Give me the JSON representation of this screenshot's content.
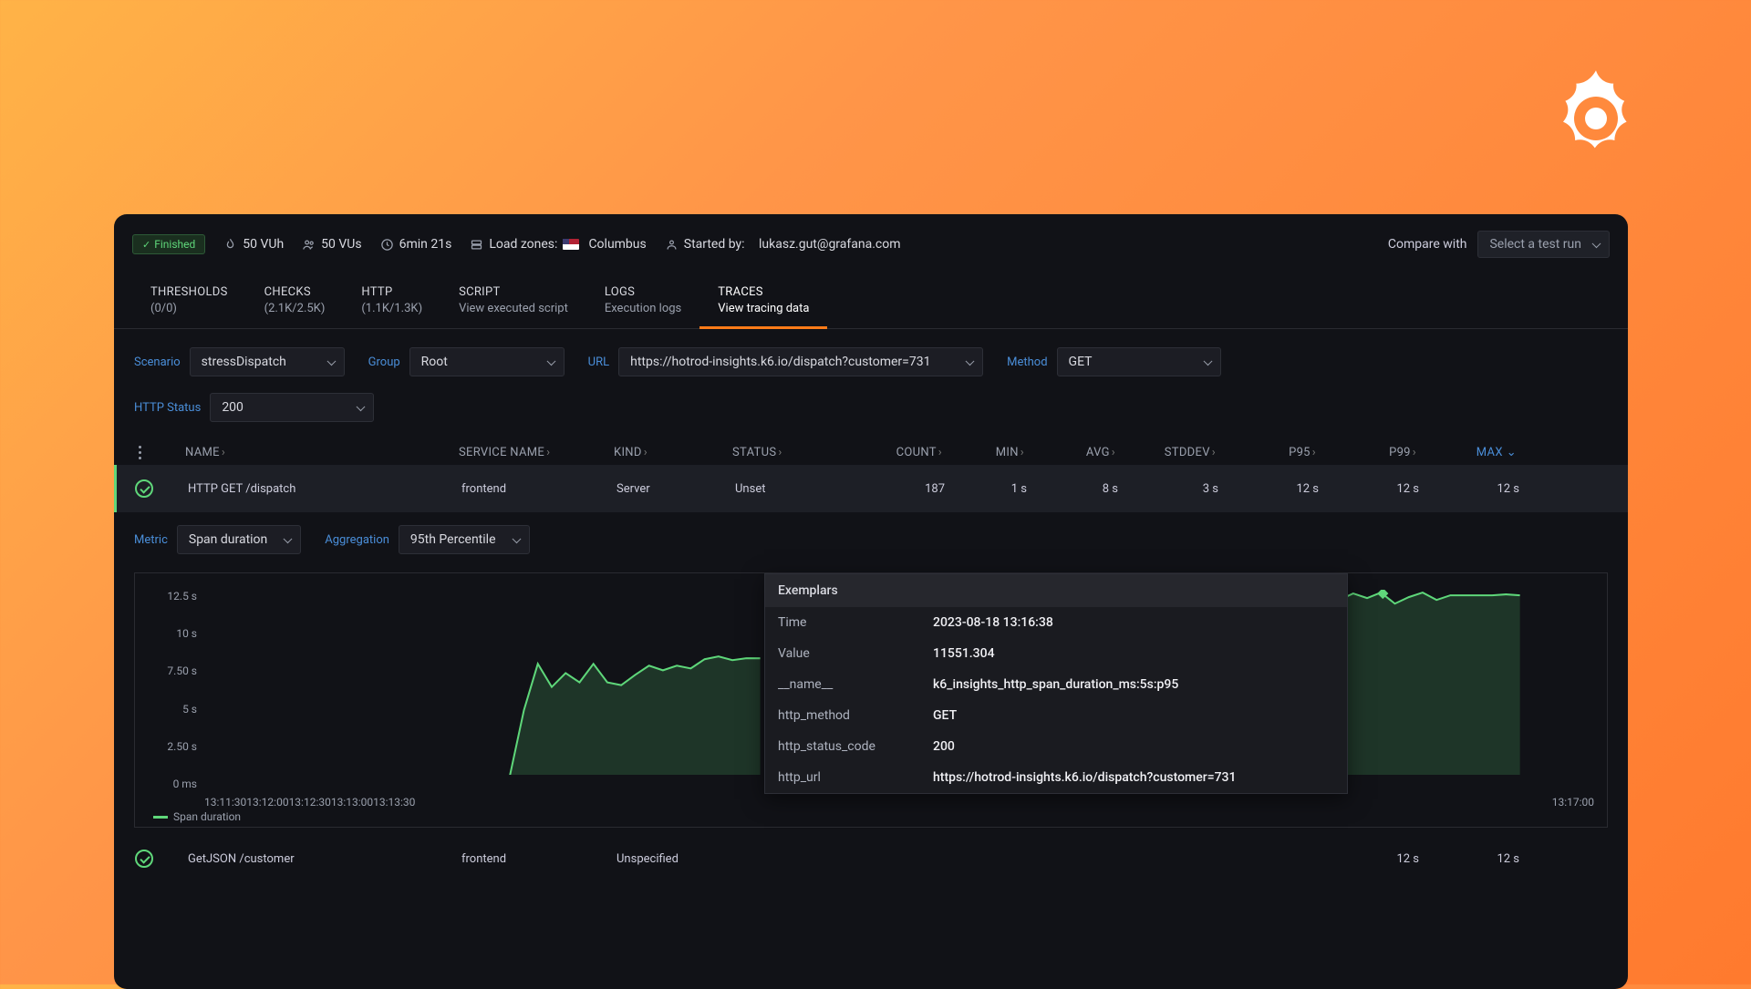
{
  "topbar": {
    "status": "Finished",
    "vuh": "50 VUh",
    "vus": "50 VUs",
    "duration": "6min 21s",
    "load_zones_label": "Load zones:",
    "load_zone": "Columbus",
    "started_by_label": "Started by:",
    "started_by": "lukasz.gut@grafana.com",
    "compare_label": "Compare with",
    "select_run": "Select a test run"
  },
  "tabs": [
    {
      "title": "THRESHOLDS",
      "sub": "(0/0)"
    },
    {
      "title": "CHECKS",
      "sub": "(2.1K/2.5K)"
    },
    {
      "title": "HTTP",
      "sub": "(1.1K/1.3K)"
    },
    {
      "title": "SCRIPT",
      "sub": "View executed script"
    },
    {
      "title": "LOGS",
      "sub": "Execution logs"
    },
    {
      "title": "TRACES",
      "sub": "View tracing data"
    }
  ],
  "filters": {
    "scenario_label": "Scenario",
    "scenario": "stressDispatch",
    "group_label": "Group",
    "group": "Root",
    "url_label": "URL",
    "url": "https://hotrod-insights.k6.io/dispatch?customer=731",
    "method_label": "Method",
    "method": "GET",
    "http_status_label": "HTTP Status",
    "http_status": "200"
  },
  "columns": {
    "name": "NAME",
    "service": "SERVICE NAME",
    "kind": "KIND",
    "status": "STATUS",
    "count": "COUNT",
    "min": "MIN",
    "avg": "AVG",
    "stddev": "STDDEV",
    "p95": "P95",
    "p99": "P99",
    "max": "MAX"
  },
  "rows": [
    {
      "name": "HTTP GET /dispatch",
      "service": "frontend",
      "kind": "Server",
      "status": "Unset",
      "count": "187",
      "min": "1 s",
      "avg": "8 s",
      "stddev": "3 s",
      "p95": "12 s",
      "p99": "12 s",
      "max": "12 s"
    },
    {
      "name": "GetJSON /customer",
      "service": "frontend",
      "kind": "Unspecified",
      "status": "",
      "count": "",
      "min": "",
      "avg": "",
      "stddev": "",
      "p95": "",
      "p99": "12 s",
      "max": "12 s"
    }
  ],
  "metricbar": {
    "metric_label": "Metric",
    "metric": "Span duration",
    "agg_label": "Aggregation",
    "agg": "95th Percentile"
  },
  "chart_data": {
    "type": "line",
    "ylabel": "",
    "ylim": [
      0,
      12.5
    ],
    "y_ticks": [
      "12.5 s",
      "10 s",
      "7.50 s",
      "5 s",
      "2.50 s",
      "0 ms"
    ],
    "x_ticks": [
      "13:11:30",
      "13:12:00",
      "13:12:30",
      "13:13:00",
      "13:13:30",
      "13:17:00"
    ],
    "series": [
      {
        "name": "Span duration",
        "values_s": [
          0,
          0,
          0,
          0,
          0,
          0,
          0,
          0,
          0,
          0,
          0,
          0,
          0,
          3.0,
          6.0,
          4.5,
          5.5,
          5.0,
          6.2,
          5.0,
          4.8,
          5.5,
          6.0,
          5.8,
          null,
          null,
          null,
          null,
          null,
          null,
          null,
          null,
          null,
          null,
          null,
          null,
          null,
          null,
          null,
          null,
          null,
          null,
          null,
          null,
          null,
          null,
          12.0,
          12.6,
          11.2,
          12.5,
          12.3,
          12.2,
          12.5,
          12.3,
          12.5,
          12.0,
          12.3,
          12.5,
          12.2,
          12.4
        ]
      }
    ],
    "legend": "Span duration"
  },
  "tooltip": {
    "header": "Exemplars",
    "rows": [
      {
        "k": "Time",
        "v": "2023-08-18 13:16:38"
      },
      {
        "k": "Value",
        "v": "11551.304"
      },
      {
        "k": "__name__",
        "v": "k6_insights_http_span_duration_ms:5s:p95"
      },
      {
        "k": "http_method",
        "v": "GET"
      },
      {
        "k": "http_status_code",
        "v": "200"
      },
      {
        "k": "http_url",
        "v": "https://hotrod-insights.k6.io/dispatch?customer=731"
      }
    ]
  }
}
